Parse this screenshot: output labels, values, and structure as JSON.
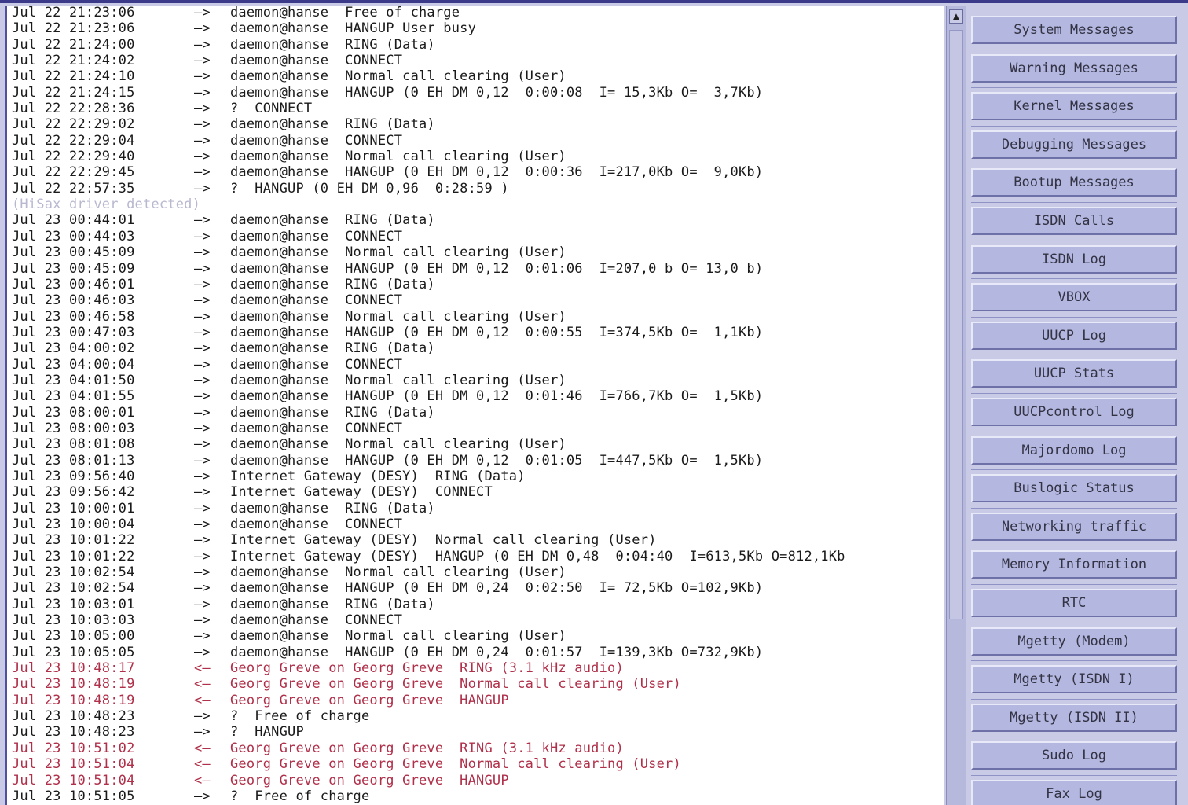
{
  "log": {
    "lines": [
      {
        "date": "Jul 22 21:23:06",
        "dir": "—>",
        "text": "daemon@hanse  Free of charge",
        "type": "normal"
      },
      {
        "date": "Jul 22 21:23:06",
        "dir": "—>",
        "text": "daemon@hanse  HANGUP User busy",
        "type": "normal"
      },
      {
        "date": "Jul 22 21:24:00",
        "dir": "—>",
        "text": "daemon@hanse  RING (Data)",
        "type": "normal"
      },
      {
        "date": "Jul 22 21:24:02",
        "dir": "—>",
        "text": "daemon@hanse  CONNECT",
        "type": "normal"
      },
      {
        "date": "Jul 22 21:24:10",
        "dir": "—>",
        "text": "daemon@hanse  Normal call clearing (User)",
        "type": "normal"
      },
      {
        "date": "Jul 22 21:24:15",
        "dir": "—>",
        "text": "daemon@hanse  HANGUP (0 EH DM 0,12  0:00:08  I= 15,3Kb O=  3,7Kb)",
        "type": "normal"
      },
      {
        "date": "Jul 22 22:28:36",
        "dir": "—>",
        "text": "?  CONNECT",
        "type": "normal"
      },
      {
        "date": "Jul 22 22:29:02",
        "dir": "—>",
        "text": "daemon@hanse  RING (Data)",
        "type": "normal"
      },
      {
        "date": "Jul 22 22:29:04",
        "dir": "—>",
        "text": "daemon@hanse  CONNECT",
        "type": "normal"
      },
      {
        "date": "Jul 22 22:29:40",
        "dir": "—>",
        "text": "daemon@hanse  Normal call clearing (User)",
        "type": "normal"
      },
      {
        "date": "Jul 22 22:29:45",
        "dir": "—>",
        "text": "daemon@hanse  HANGUP (0 EH DM 0,12  0:00:36  I=217,0Kb O=  9,0Kb)",
        "type": "normal"
      },
      {
        "date": "Jul 22 22:57:35",
        "dir": "—>",
        "text": "?  HANGUP (0 EH DM 0,96  0:28:59 )",
        "type": "normal"
      },
      {
        "date": "(HiSax driver detected)",
        "dir": "",
        "text": "",
        "type": "system"
      },
      {
        "date": "Jul 23 00:44:01",
        "dir": "—>",
        "text": "daemon@hanse  RING (Data)",
        "type": "normal"
      },
      {
        "date": "Jul 23 00:44:03",
        "dir": "—>",
        "text": "daemon@hanse  CONNECT",
        "type": "normal"
      },
      {
        "date": "Jul 23 00:45:09",
        "dir": "—>",
        "text": "daemon@hanse  Normal call clearing (User)",
        "type": "normal"
      },
      {
        "date": "Jul 23 00:45:09",
        "dir": "—>",
        "text": "daemon@hanse  HANGUP (0 EH DM 0,12  0:01:06  I=207,0 b O= 13,0 b)",
        "type": "normal"
      },
      {
        "date": "Jul 23 00:46:01",
        "dir": "—>",
        "text": "daemon@hanse  RING (Data)",
        "type": "normal"
      },
      {
        "date": "Jul 23 00:46:03",
        "dir": "—>",
        "text": "daemon@hanse  CONNECT",
        "type": "normal"
      },
      {
        "date": "Jul 23 00:46:58",
        "dir": "—>",
        "text": "daemon@hanse  Normal call clearing (User)",
        "type": "normal"
      },
      {
        "date": "Jul 23 00:47:03",
        "dir": "—>",
        "text": "daemon@hanse  HANGUP (0 EH DM 0,12  0:00:55  I=374,5Kb O=  1,1Kb)",
        "type": "normal"
      },
      {
        "date": "Jul 23 04:00:02",
        "dir": "—>",
        "text": "daemon@hanse  RING (Data)",
        "type": "normal"
      },
      {
        "date": "Jul 23 04:00:04",
        "dir": "—>",
        "text": "daemon@hanse  CONNECT",
        "type": "normal"
      },
      {
        "date": "Jul 23 04:01:50",
        "dir": "—>",
        "text": "daemon@hanse  Normal call clearing (User)",
        "type": "normal"
      },
      {
        "date": "Jul 23 04:01:55",
        "dir": "—>",
        "text": "daemon@hanse  HANGUP (0 EH DM 0,12  0:01:46  I=766,7Kb O=  1,5Kb)",
        "type": "normal"
      },
      {
        "date": "Jul 23 08:00:01",
        "dir": "—>",
        "text": "daemon@hanse  RING (Data)",
        "type": "normal"
      },
      {
        "date": "Jul 23 08:00:03",
        "dir": "—>",
        "text": "daemon@hanse  CONNECT",
        "type": "normal"
      },
      {
        "date": "Jul 23 08:01:08",
        "dir": "—>",
        "text": "daemon@hanse  Normal call clearing (User)",
        "type": "normal"
      },
      {
        "date": "Jul 23 08:01:13",
        "dir": "—>",
        "text": "daemon@hanse  HANGUP (0 EH DM 0,12  0:01:05  I=447,5Kb O=  1,5Kb)",
        "type": "normal"
      },
      {
        "date": "Jul 23 09:56:40",
        "dir": "—>",
        "text": "Internet Gateway (DESY)  RING (Data)",
        "type": "normal"
      },
      {
        "date": "Jul 23 09:56:42",
        "dir": "—>",
        "text": "Internet Gateway (DESY)  CONNECT",
        "type": "normal"
      },
      {
        "date": "Jul 23 10:00:01",
        "dir": "—>",
        "text": "daemon@hanse  RING (Data)",
        "type": "normal"
      },
      {
        "date": "Jul 23 10:00:04",
        "dir": "—>",
        "text": "daemon@hanse  CONNECT",
        "type": "normal"
      },
      {
        "date": "Jul 23 10:01:22",
        "dir": "—>",
        "text": "Internet Gateway (DESY)  Normal call clearing (User)",
        "type": "normal"
      },
      {
        "date": "Jul 23 10:01:22",
        "dir": "—>",
        "text": "Internet Gateway (DESY)  HANGUP (0 EH DM 0,48  0:04:40  I=613,5Kb O=812,1Kb",
        "type": "normal"
      },
      {
        "date": "Jul 23 10:02:54",
        "dir": "—>",
        "text": "daemon@hanse  Normal call clearing (User)",
        "type": "normal"
      },
      {
        "date": "Jul 23 10:02:54",
        "dir": "—>",
        "text": "daemon@hanse  HANGUP (0 EH DM 0,24  0:02:50  I= 72,5Kb O=102,9Kb)",
        "type": "normal"
      },
      {
        "date": "Jul 23 10:03:01",
        "dir": "—>",
        "text": "daemon@hanse  RING (Data)",
        "type": "normal"
      },
      {
        "date": "Jul 23 10:03:03",
        "dir": "—>",
        "text": "daemon@hanse  CONNECT",
        "type": "normal"
      },
      {
        "date": "Jul 23 10:05:00",
        "dir": "—>",
        "text": "daemon@hanse  Normal call clearing (User)",
        "type": "normal"
      },
      {
        "date": "Jul 23 10:05:05",
        "dir": "—>",
        "text": "daemon@hanse  HANGUP (0 EH DM 0,24  0:01:57  I=139,3Kb O=732,9Kb)",
        "type": "normal"
      },
      {
        "date": "Jul 23 10:48:17",
        "dir": "<—",
        "text": "Georg Greve on Georg Greve  RING (3.1 kHz audio)",
        "type": "incoming"
      },
      {
        "date": "Jul 23 10:48:19",
        "dir": "<—",
        "text": "Georg Greve on Georg Greve  Normal call clearing (User)",
        "type": "incoming"
      },
      {
        "date": "Jul 23 10:48:19",
        "dir": "<—",
        "text": "Georg Greve on Georg Greve  HANGUP",
        "type": "incoming"
      },
      {
        "date": "Jul 23 10:48:23",
        "dir": "—>",
        "text": "?  Free of charge",
        "type": "normal"
      },
      {
        "date": "Jul 23 10:48:23",
        "dir": "—>",
        "text": "?  HANGUP",
        "type": "normal"
      },
      {
        "date": "Jul 23 10:51:02",
        "dir": "<—",
        "text": "Georg Greve on Georg Greve  RING (3.1 kHz audio)",
        "type": "incoming"
      },
      {
        "date": "Jul 23 10:51:04",
        "dir": "<—",
        "text": "Georg Greve on Georg Greve  Normal call clearing (User)",
        "type": "incoming"
      },
      {
        "date": "Jul 23 10:51:04",
        "dir": "<—",
        "text": "Georg Greve on Georg Greve  HANGUP",
        "type": "incoming"
      },
      {
        "date": "Jul 23 10:51:05",
        "dir": "—>",
        "text": "?  Free of charge",
        "type": "normal"
      }
    ]
  },
  "scrollbar": {
    "up_arrow": "▲",
    "icon": "scroll-up-arrow-icon"
  },
  "buttons": [
    "System Messages",
    "Warning Messages",
    "Kernel Messages",
    "Debugging Messages",
    "Bootup Messages",
    "ISDN Calls",
    "ISDN Log",
    "VBOX",
    "UUCP Log",
    "UUCP Stats",
    "UUCPcontrol Log",
    "Majordomo Log",
    "Buslogic Status",
    "Networking traffic",
    "Memory Information",
    "RTC",
    "Mgetty (Modem)",
    "Mgetty (ISDN I)",
    "Mgetty (ISDN II)",
    "Sudo Log",
    "Fax Log"
  ],
  "colors": {
    "incoming_text": "#b0304a",
    "normal_text": "#1a1a1a",
    "button_face": "#b4b7e0",
    "panel_bg": "#c9cbe6"
  }
}
